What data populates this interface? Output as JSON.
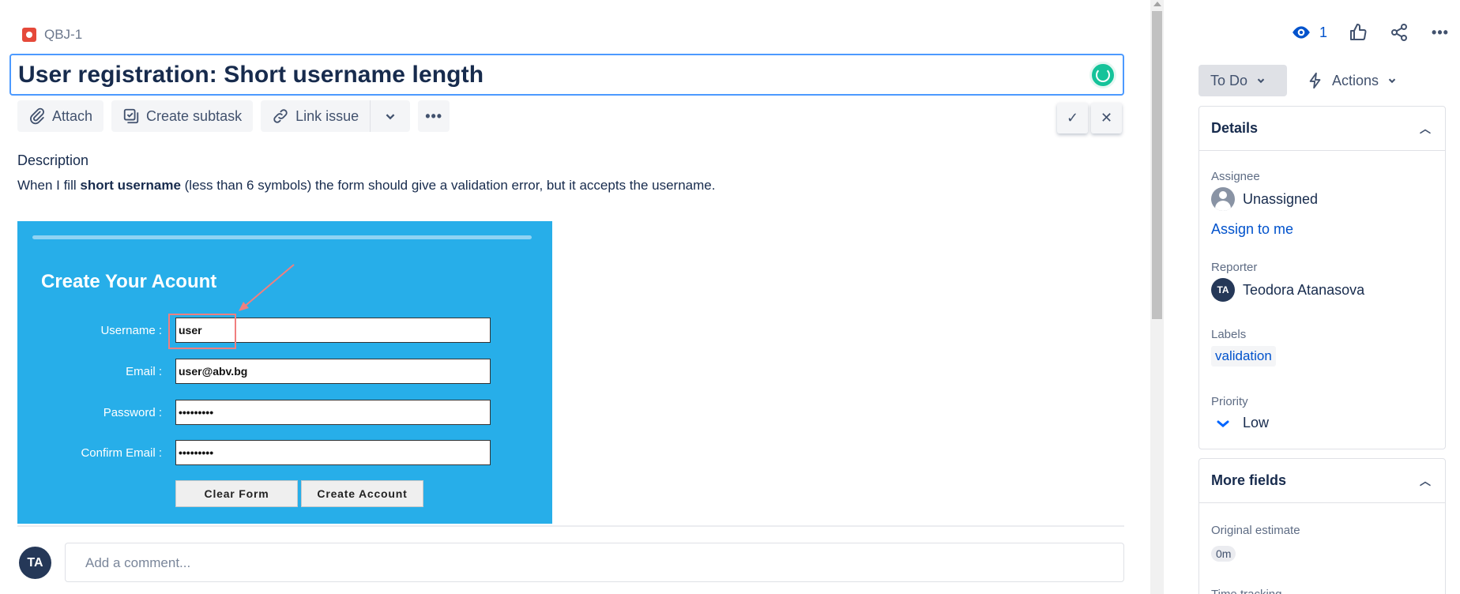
{
  "issue": {
    "key": "QBJ-1",
    "title": "User registration: Short username length"
  },
  "toolbar": {
    "attach": "Attach",
    "create_subtask": "Create subtask",
    "link_issue": "Link issue"
  },
  "description": {
    "label": "Description",
    "text_before": "When I fill ",
    "text_bold": "short username",
    "text_after": " (less than 6 symbols) the form should give a validation error, but it accepts the username."
  },
  "attachment": {
    "form_title": "Create Your Acount",
    "fields": [
      {
        "label": "Username :",
        "value": "user"
      },
      {
        "label": "Email :",
        "value": "user@abv.bg"
      },
      {
        "label": "Password :",
        "value": "•••••••••"
      },
      {
        "label": "Confirm Email :",
        "value": "•••••••••"
      }
    ],
    "buttons": {
      "clear": "Clear Form",
      "create": "Create Account"
    }
  },
  "comment": {
    "avatar_initials": "TA",
    "placeholder": "Add a comment..."
  },
  "sidebar": {
    "watch_count": "1",
    "status": "To Do",
    "actions": "Actions",
    "details_title": "Details",
    "assignee_label": "Assignee",
    "assignee_value": "Unassigned",
    "assign_to_me": "Assign to me",
    "reporter_label": "Reporter",
    "reporter_initials": "TA",
    "reporter_value": "Teodora Atanasova",
    "labels_label": "Labels",
    "label_value": "validation",
    "priority_label": "Priority",
    "priority_value": "Low",
    "more_fields_title": "More fields",
    "original_estimate_label": "Original estimate",
    "original_estimate_value": "0m",
    "time_tracking_label": "Time tracking"
  },
  "colors": {
    "accent": "#0052cc",
    "bug": "#e5493a",
    "screenshot_bg": "#27aee9",
    "highlight": "#f07f7f"
  }
}
